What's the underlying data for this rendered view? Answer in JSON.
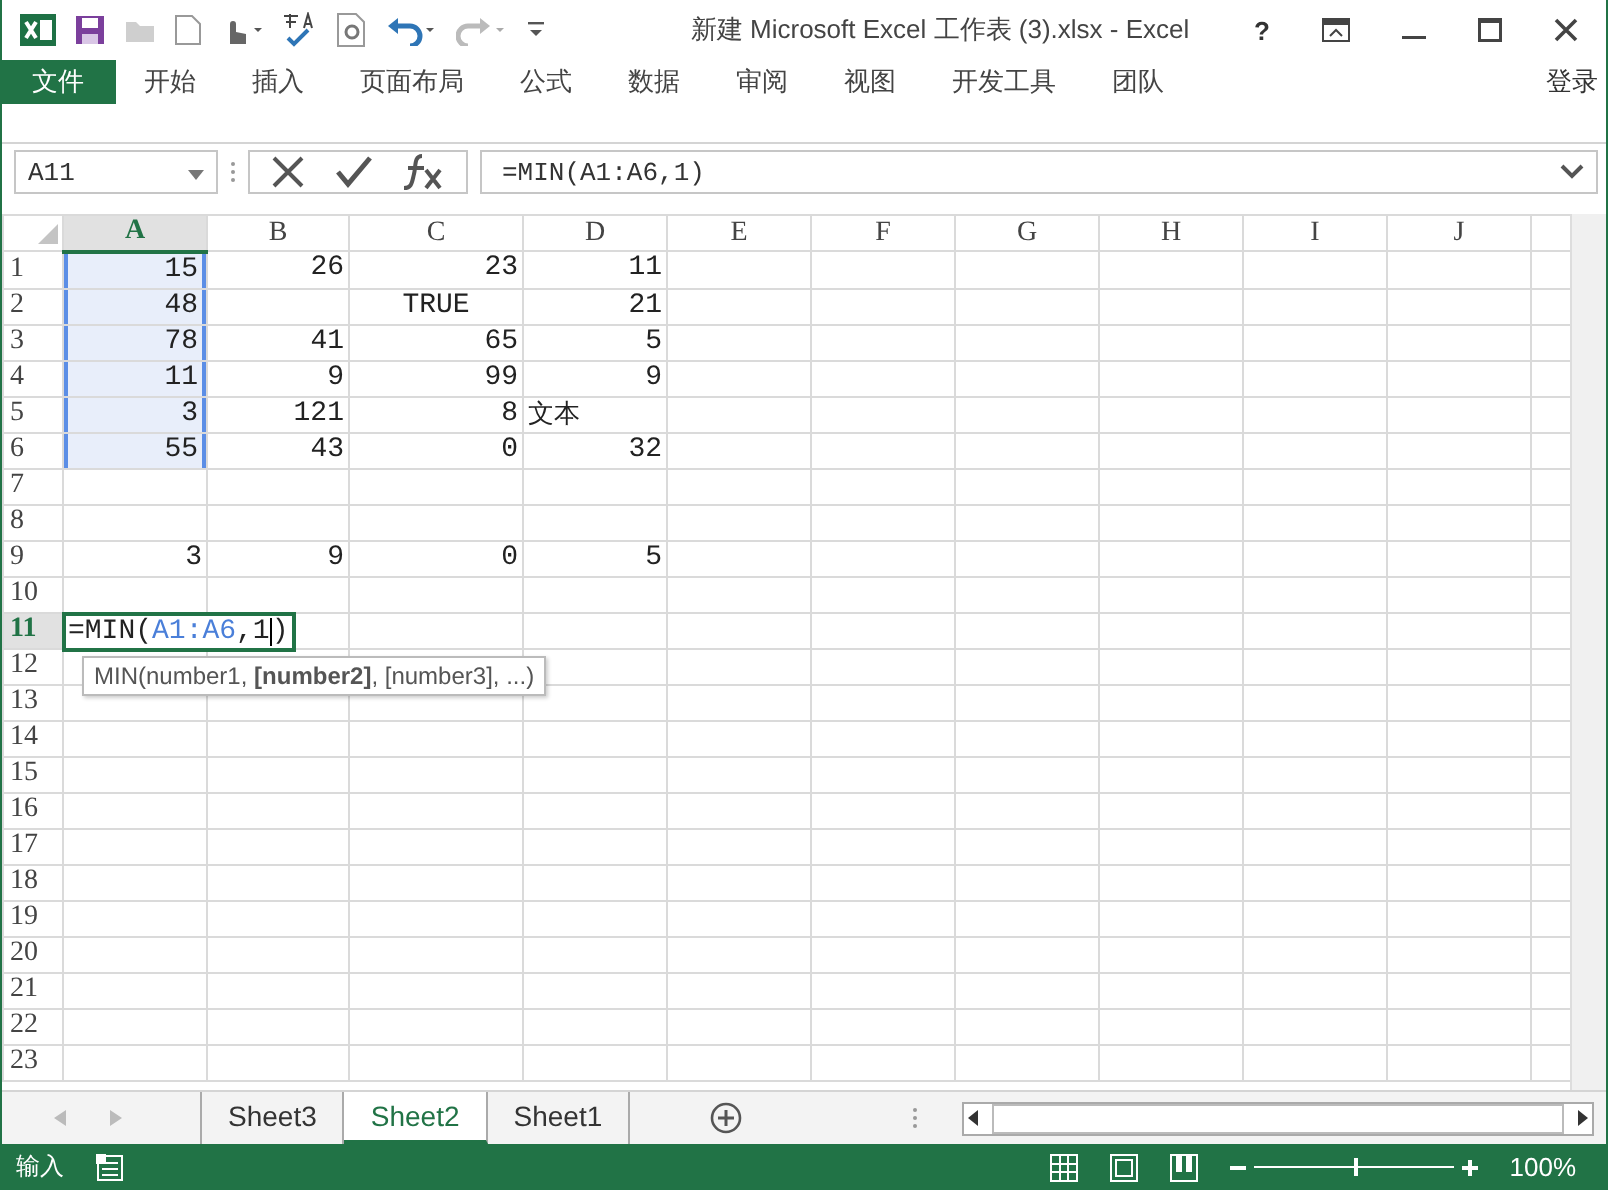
{
  "window": {
    "title": "新建 Microsoft Excel 工作表 (3).xlsx - Excel",
    "help": "?"
  },
  "ribbon_tabs": [
    {
      "label": "文件",
      "kind": "file"
    },
    {
      "label": "开始",
      "kind": "tab"
    },
    {
      "label": "插入",
      "kind": "tab"
    },
    {
      "label": "页面布局",
      "kind": "tab"
    },
    {
      "label": "公式",
      "kind": "tab"
    },
    {
      "label": "数据",
      "kind": "tab"
    },
    {
      "label": "审阅",
      "kind": "tab"
    },
    {
      "label": "视图",
      "kind": "tab"
    },
    {
      "label": "开发工具",
      "kind": "tab"
    },
    {
      "label": "团队",
      "kind": "tab"
    }
  ],
  "sign_in": "登录",
  "formula_bar": {
    "name_box": "A11",
    "formula": "=MIN(A1:A6,1)"
  },
  "columns": [
    {
      "label": "A",
      "selected": true
    },
    {
      "label": "B",
      "selected": false
    },
    {
      "label": "C",
      "selected": false
    },
    {
      "label": "D",
      "selected": false
    },
    {
      "label": "E",
      "selected": false
    },
    {
      "label": "F",
      "selected": false
    },
    {
      "label": "G",
      "selected": false
    },
    {
      "label": "H",
      "selected": false
    },
    {
      "label": "I",
      "selected": false
    },
    {
      "label": "J",
      "selected": false
    }
  ],
  "rows": [
    {
      "label": "1",
      "selected": false,
      "cells": [
        {
          "text": "15",
          "kind": "number",
          "highlighted": true
        },
        {
          "text": "26",
          "kind": "number",
          "highlighted": false
        },
        {
          "text": "23",
          "kind": "number",
          "highlighted": false
        },
        {
          "text": "11",
          "kind": "number",
          "highlighted": false
        }
      ]
    },
    {
      "label": "2",
      "selected": false,
      "cells": [
        {
          "text": "48",
          "kind": "number",
          "highlighted": true
        },
        {
          "kind": "blank"
        },
        {
          "text": "TRUE",
          "kind": "bool",
          "highlighted": false
        },
        {
          "text": "21",
          "kind": "number",
          "highlighted": false
        }
      ]
    },
    {
      "label": "3",
      "selected": false,
      "cells": [
        {
          "text": "78",
          "kind": "number",
          "highlighted": true
        },
        {
          "text": "41",
          "kind": "number",
          "highlighted": false
        },
        {
          "text": "65",
          "kind": "number",
          "highlighted": false
        },
        {
          "text": "5",
          "kind": "number",
          "highlighted": false
        }
      ]
    },
    {
      "label": "4",
      "selected": false,
      "cells": [
        {
          "text": "11",
          "kind": "number",
          "highlighted": true
        },
        {
          "text": "9",
          "kind": "number",
          "highlighted": false
        },
        {
          "text": "99",
          "kind": "number",
          "highlighted": false
        },
        {
          "text": "9",
          "kind": "number",
          "highlighted": false
        }
      ]
    },
    {
      "label": "5",
      "selected": false,
      "cells": [
        {
          "text": "3",
          "kind": "number",
          "highlighted": true
        },
        {
          "text": "121",
          "kind": "number",
          "highlighted": false
        },
        {
          "text": "8",
          "kind": "number",
          "highlighted": false
        },
        {
          "text": "文本",
          "kind": "text",
          "highlighted": false
        }
      ]
    },
    {
      "label": "6",
      "selected": false,
      "cells": [
        {
          "text": "55",
          "kind": "number",
          "highlighted": true
        },
        {
          "text": "43",
          "kind": "number",
          "highlighted": false
        },
        {
          "text": "0",
          "kind": "number",
          "highlighted": false
        },
        {
          "text": "32",
          "kind": "number",
          "highlighted": false
        }
      ]
    },
    {
      "label": "7",
      "selected": false,
      "cells": []
    },
    {
      "label": "8",
      "selected": false,
      "cells": []
    },
    {
      "label": "9",
      "selected": false,
      "cells": [
        {
          "text": "3",
          "kind": "number",
          "highlighted": false
        },
        {
          "text": "9",
          "kind": "number",
          "highlighted": false
        },
        {
          "text": "0",
          "kind": "number",
          "highlighted": false
        },
        {
          "text": "5",
          "kind": "number",
          "highlighted": false
        }
      ]
    },
    {
      "label": "10",
      "selected": false,
      "cells": []
    },
    {
      "label": "11",
      "selected": true,
      "cells": [
        {
          "kind": "formula",
          "parts": [
            {
              "text": "=MIN(",
              "ref": false
            },
            {
              "text": "A1:A6",
              "ref": true
            },
            {
              "text": ",1",
              "ref": false
            },
            {
              "text": ")",
              "ref": false
            }
          ]
        }
      ]
    },
    {
      "label": "12",
      "selected": false,
      "cells": []
    },
    {
      "label": "13",
      "selected": false,
      "cells": []
    },
    {
      "label": "14",
      "selected": false,
      "cells": []
    },
    {
      "label": "15",
      "selected": false,
      "cells": []
    },
    {
      "label": "16",
      "selected": false,
      "cells": []
    },
    {
      "label": "17",
      "selected": false,
      "cells": []
    },
    {
      "label": "18",
      "selected": false,
      "cells": []
    },
    {
      "label": "19",
      "selected": false,
      "cells": []
    },
    {
      "label": "20",
      "selected": false,
      "cells": []
    },
    {
      "label": "21",
      "selected": false,
      "cells": []
    },
    {
      "label": "22",
      "selected": false,
      "cells": []
    },
    {
      "label": "23",
      "selected": false,
      "cells": []
    }
  ],
  "tooltip": "MIN(number1, **[number2]**, [number3], ...)",
  "sheet_tabs": [
    {
      "label": "Sheet3",
      "selected": false
    },
    {
      "label": "Sheet2",
      "selected": true
    },
    {
      "label": "Sheet1",
      "selected": false
    }
  ],
  "status_bar": {
    "mode": "输入",
    "zoom": "100%",
    "zoom_slider": {
      "level": 0.5
    }
  }
}
